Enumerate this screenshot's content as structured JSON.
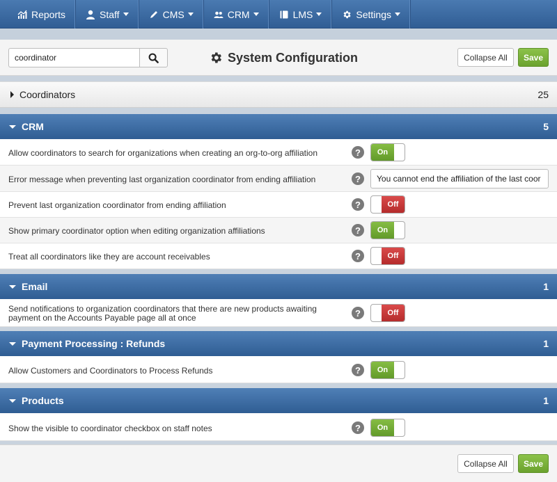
{
  "nav": [
    {
      "label": "Reports",
      "icon": "chart-icon",
      "has_caret": false
    },
    {
      "label": "Staff",
      "icon": "user-icon",
      "has_caret": true
    },
    {
      "label": "CMS",
      "icon": "pencil-icon",
      "has_caret": true
    },
    {
      "label": "CRM",
      "icon": "users-icon",
      "has_caret": true
    },
    {
      "label": "LMS",
      "icon": "book-icon",
      "has_caret": true
    },
    {
      "label": "Settings",
      "icon": "gear-icon",
      "has_caret": true
    }
  ],
  "header": {
    "search_value": "coordinator",
    "title": "System Configuration",
    "collapse_label": "Collapse All",
    "save_label": "Save"
  },
  "coordinators_bar": {
    "label": "Coordinators",
    "count": "25"
  },
  "sections": {
    "crm": {
      "title": "CRM",
      "count": "5",
      "settings": [
        {
          "label": "Allow coordinators to search for organizations when creating an org-to-org affiliation",
          "state": "On"
        },
        {
          "label": "Error message when preventing last organization coordinator from ending affiliation",
          "value": "You cannot end the affiliation of the last coor"
        },
        {
          "label": "Prevent last organization coordinator from ending affiliation",
          "state": "Off"
        },
        {
          "label": "Show primary coordinator option when editing organization affiliations",
          "state": "On"
        },
        {
          "label": "Treat all coordinators like they are account receivables",
          "state": "Off"
        }
      ]
    },
    "email": {
      "title": "Email",
      "count": "1",
      "settings": [
        {
          "label_line1": "Send notifications to organization coordinators that there are new products awaiting",
          "label_line2": "payment on the Accounts Payable page all at once",
          "state": "Off"
        }
      ]
    },
    "refunds": {
      "title": "Payment Processing : Refunds",
      "count": "1",
      "settings": [
        {
          "label": "Allow Customers and Coordinators to Process Refunds",
          "state": "On"
        }
      ]
    },
    "products": {
      "title": "Products",
      "count": "1",
      "settings": [
        {
          "label": "Show the visible to coordinator checkbox on staff notes",
          "state": "On"
        }
      ]
    }
  },
  "help_glyph": "?",
  "footer": {
    "collapse_label": "Collapse All",
    "save_label": "Save"
  },
  "colors": {
    "nav_blue": "#305d94",
    "toggle_on": "#6ba22e",
    "toggle_off": "#b52c2c",
    "save_green": "#7ab23b"
  }
}
